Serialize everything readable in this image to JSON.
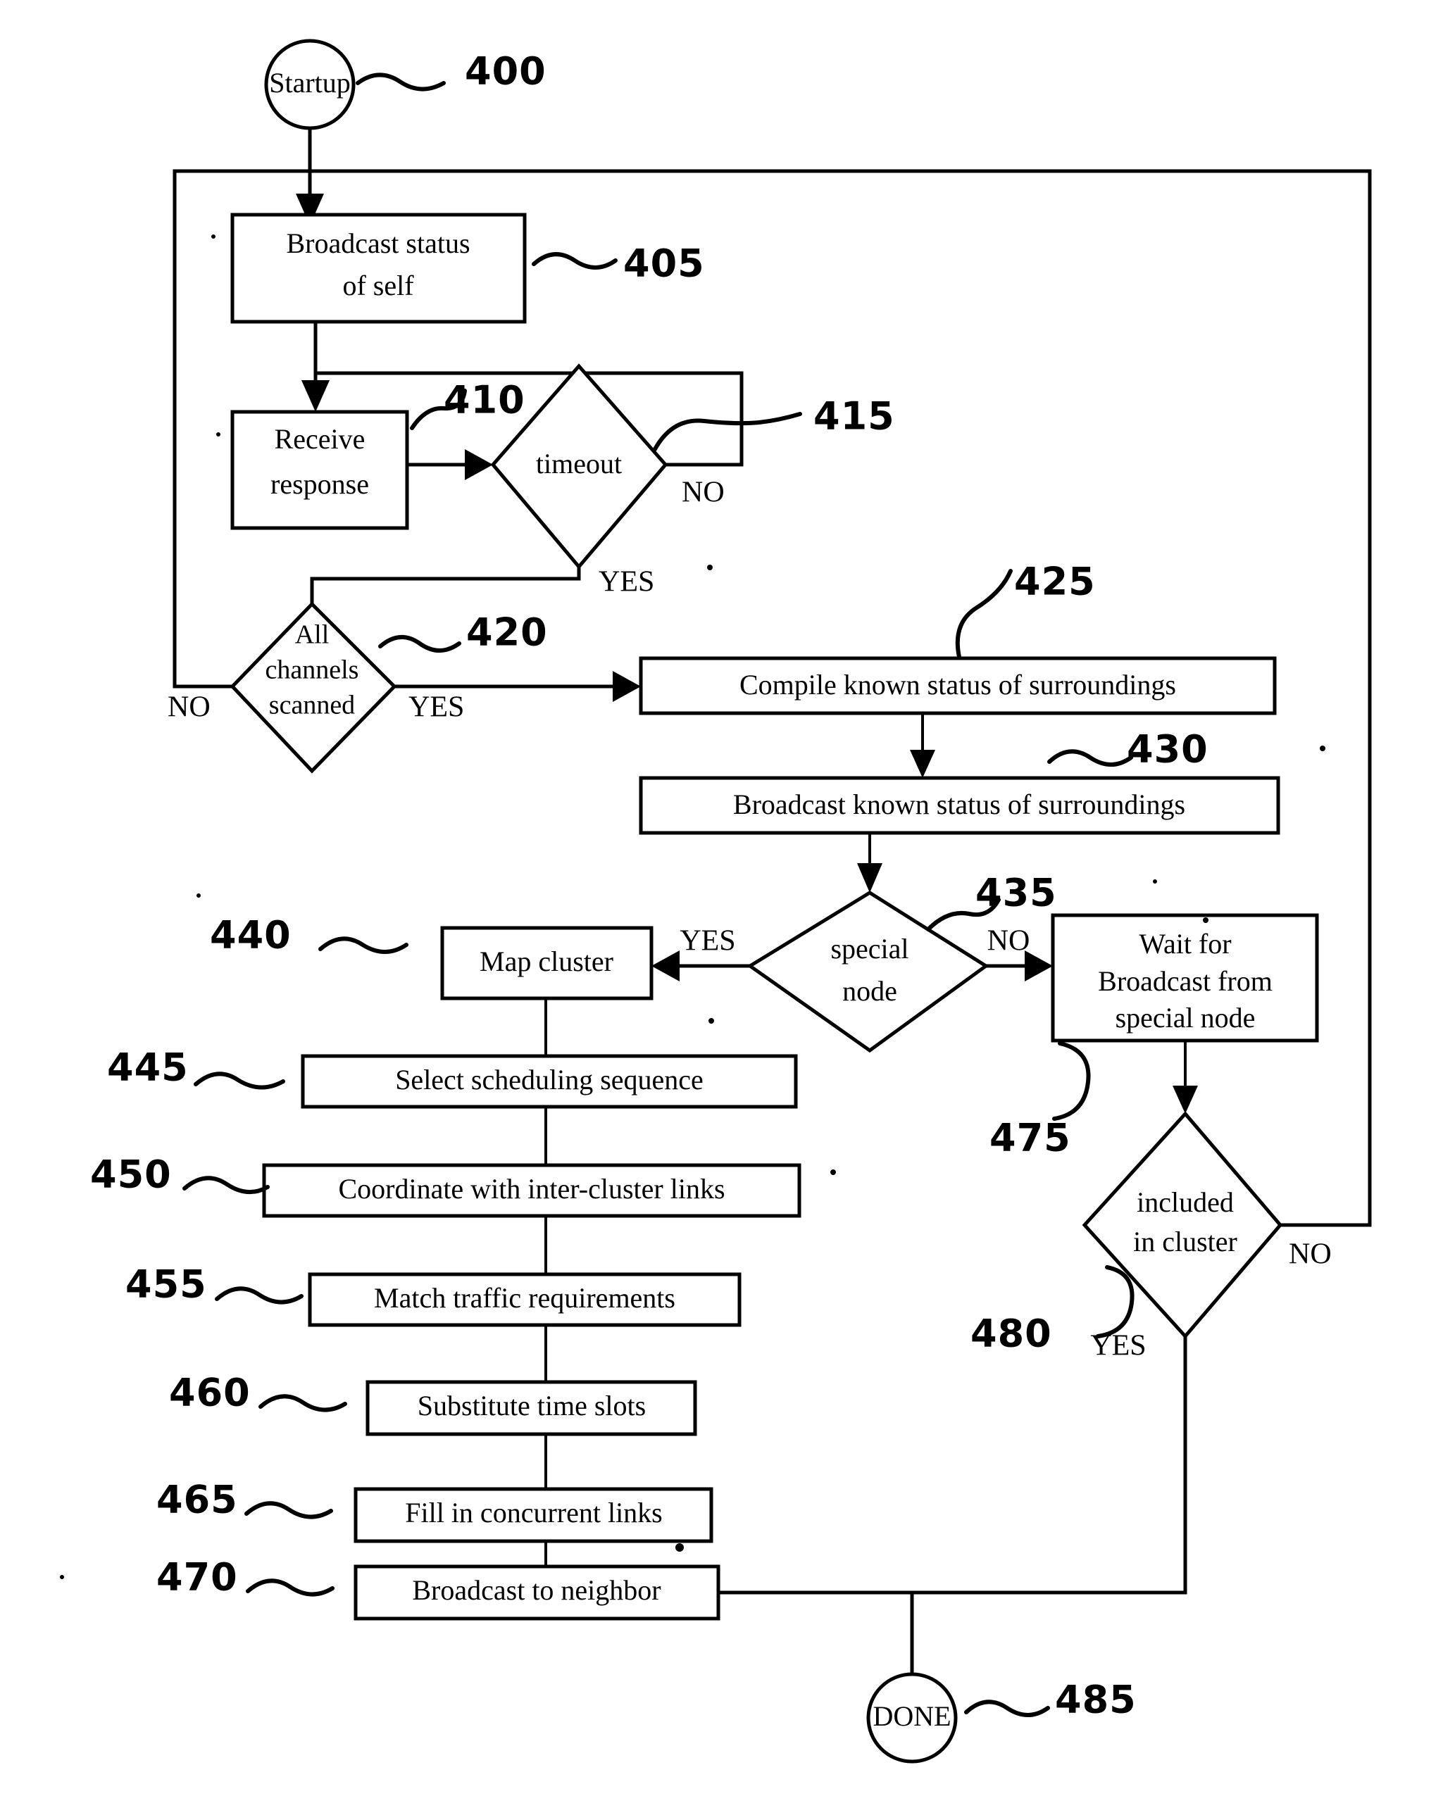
{
  "figure": {
    "type": "patent-flowchart",
    "terminals": [
      {
        "id": "startup",
        "label": "Startup",
        "ref": "400"
      },
      {
        "id": "done",
        "label": "DONE",
        "ref": "485"
      }
    ],
    "processes": [
      {
        "id": "broadcast-status-self",
        "label_line1": "Broadcast status",
        "label_line2": "of self",
        "ref": "405"
      },
      {
        "id": "receive-response",
        "label_line1": "Receive",
        "label_line2": "response",
        "ref": "410"
      },
      {
        "id": "compile-known-status",
        "label_line1": "Compile known status of surroundings",
        "label_line2": "",
        "ref": "425"
      },
      {
        "id": "broadcast-known-status",
        "label_line1": "Broadcast known status of surroundings",
        "label_line2": "",
        "ref": "430"
      },
      {
        "id": "map-cluster",
        "label_line1": "Map cluster",
        "label_line2": "",
        "ref": "440"
      },
      {
        "id": "select-scheduling-sequence",
        "label_line1": "Select scheduling sequence",
        "label_line2": "",
        "ref": "445"
      },
      {
        "id": "coordinate-inter-cluster-links",
        "label_line1": "Coordinate with inter-cluster links",
        "label_line2": "",
        "ref": "450"
      },
      {
        "id": "match-traffic-requirements",
        "label_line1": "Match traffic requirements",
        "label_line2": "",
        "ref": "455"
      },
      {
        "id": "substitute-time-slots",
        "label_line1": "Substitute time slots",
        "label_line2": "",
        "ref": "460"
      },
      {
        "id": "fill-in-concurrent-links",
        "label_line1": "Fill in concurrent links",
        "label_line2": "",
        "ref": "465"
      },
      {
        "id": "broadcast-to-neighbor",
        "label_line1": "Broadcast to neighbor",
        "label_line2": "",
        "ref": "470"
      },
      {
        "id": "wait-for-broadcast",
        "label_line1": "Wait for",
        "label_line2": "Broadcast from",
        "label_line3": "special node",
        "ref": "475"
      }
    ],
    "decisions": [
      {
        "id": "timeout",
        "label_line1": "timeout",
        "label_line2": "",
        "ref": "415",
        "yes_label": "YES",
        "no_label": "NO",
        "yes_side": "bottom",
        "no_side": "right"
      },
      {
        "id": "all-channels-scanned",
        "label_line1": "All",
        "label_line2": "channels",
        "label_line3": "scanned",
        "ref": "420",
        "yes_label": "YES",
        "no_label": "NO",
        "yes_side": "right",
        "no_side": "left"
      },
      {
        "id": "special-node",
        "label_line1": "special",
        "label_line2": "node",
        "ref": "435",
        "yes_label": "YES",
        "no_label": "NO",
        "yes_side": "left",
        "no_side": "right"
      },
      {
        "id": "included-in-cluster",
        "label_line1": "included",
        "label_line2": "in cluster",
        "ref": "480",
        "yes_label": "YES",
        "no_label": "NO",
        "yes_side": "bottom",
        "no_side": "right"
      }
    ],
    "reference_numerals": [
      "400",
      "405",
      "410",
      "415",
      "420",
      "425",
      "430",
      "435",
      "440",
      "445",
      "450",
      "455",
      "460",
      "465",
      "470",
      "475",
      "480",
      "485"
    ],
    "branch_labels": [
      "YES",
      "NO"
    ]
  }
}
